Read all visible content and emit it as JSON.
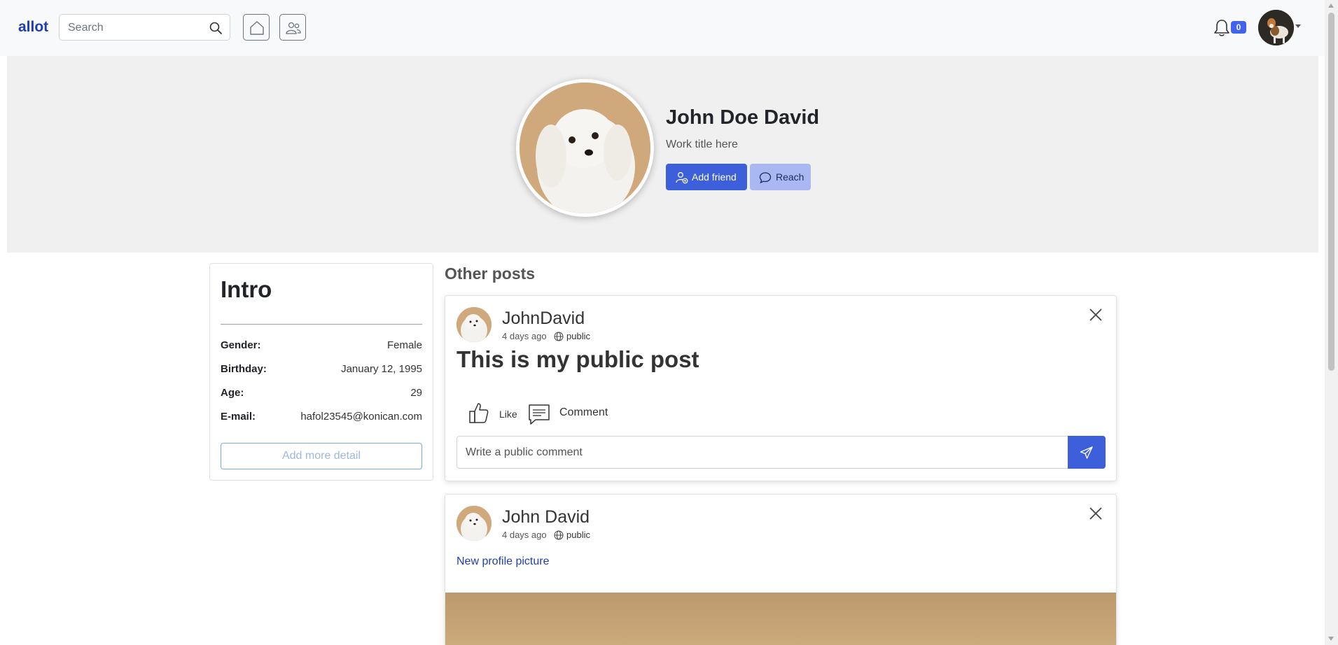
{
  "navbar": {
    "brand": "allot",
    "search_placeholder": "Search",
    "notification_count": "0"
  },
  "profile": {
    "name": "John Doe David",
    "work_title": "Work title here",
    "add_friend_label": "Add friend",
    "reach_label": "Reach"
  },
  "intro": {
    "title": "Intro",
    "rows": [
      {
        "label": "Gender:",
        "value": "Female"
      },
      {
        "label": "Birthday:",
        "value": "January 12, 1995"
      },
      {
        "label": "Age:",
        "value": "29"
      },
      {
        "label": "E-mail:",
        "value": "hafol23545@konican.com"
      }
    ],
    "add_more_label": "Add more detail"
  },
  "posts": {
    "section_title": "Other posts",
    "items": [
      {
        "author": "JohnDavid",
        "time": "4 days ago",
        "visibility": "public",
        "text": "This is my public post",
        "like_label": "Like",
        "comment_label": "Comment",
        "comment_placeholder": "Write a public comment"
      },
      {
        "author": "John David",
        "time": "4 days ago",
        "visibility": "public",
        "link_text": "New profile picture"
      }
    ]
  },
  "colors": {
    "brand": "#1f3fb0",
    "primary": "#3d5fd9",
    "primary_light": "#a9b8f3",
    "cover_bg": "#f0f0f0"
  }
}
